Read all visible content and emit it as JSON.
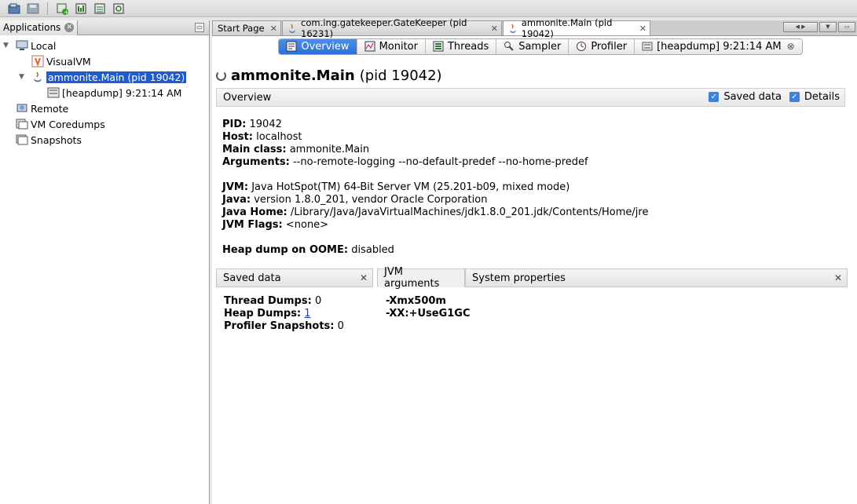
{
  "toolbar": {
    "buttons": [
      "open-file-icon",
      "save-file-icon",
      "add-jmx-icon",
      "heap-dump-icon",
      "thread-dump-icon",
      "snapshot-icon"
    ]
  },
  "left_panel": {
    "tab_label": "Applications",
    "tree": {
      "local": "Local",
      "visualvm": "VisualVM",
      "ammonite": "ammonite.Main (pid 19042)",
      "heapdump": "[heapdump] 9:21:14 AM",
      "remote": "Remote",
      "coredumps": "VM Coredumps",
      "snapshots": "Snapshots"
    }
  },
  "doc_tabs": [
    {
      "label": "Start Page"
    },
    {
      "label": "com.ing.gatekeeper.GateKeeper (pid 16231)"
    },
    {
      "label": "ammonite.Main (pid 19042)"
    }
  ],
  "sub_tabs": {
    "overview": "Overview",
    "monitor": "Monitor",
    "threads": "Threads",
    "sampler": "Sampler",
    "profiler": "Profiler",
    "heapdump": "[heapdump] 9:21:14 AM"
  },
  "page": {
    "title_bold": "ammonite.Main",
    "title_rest": "(pid 19042)"
  },
  "overview_bar": {
    "label": "Overview",
    "saved_data": "Saved data",
    "details": "Details"
  },
  "info": {
    "pid_label": "PID:",
    "pid": "19042",
    "host_label": "Host:",
    "host": "localhost",
    "main_class_label": "Main class:",
    "main_class": "ammonite.Main",
    "arguments_label": "Arguments:",
    "arguments": "--no-remote-logging --no-default-predef --no-home-predef",
    "jvm_label": "JVM:",
    "jvm": "Java HotSpot(TM) 64-Bit Server VM (25.201-b09, mixed mode)",
    "java_label": "Java:",
    "java": "version 1.8.0_201, vendor Oracle Corporation",
    "java_home_label": "Java Home:",
    "java_home": "/Library/Java/JavaVirtualMachines/jdk1.8.0_201.jdk/Contents/Home/jre",
    "jvm_flags_label": "JVM Flags:",
    "jvm_flags": "<none>",
    "oome_label": "Heap dump on OOME:",
    "oome": "disabled"
  },
  "bottom_tabs": {
    "saved_data": "Saved data",
    "jvm_arguments": "JVM arguments",
    "system_properties": "System properties"
  },
  "saved_data": {
    "thread_dumps_label": "Thread Dumps:",
    "thread_dumps": "0",
    "heap_dumps_label": "Heap Dumps:",
    "heap_dumps": "1",
    "profiler_snapshots_label": "Profiler Snapshots:",
    "profiler_snapshots": "0"
  },
  "jvm_arguments": [
    "-Xmx500m",
    "-XX:+UseG1GC"
  ]
}
